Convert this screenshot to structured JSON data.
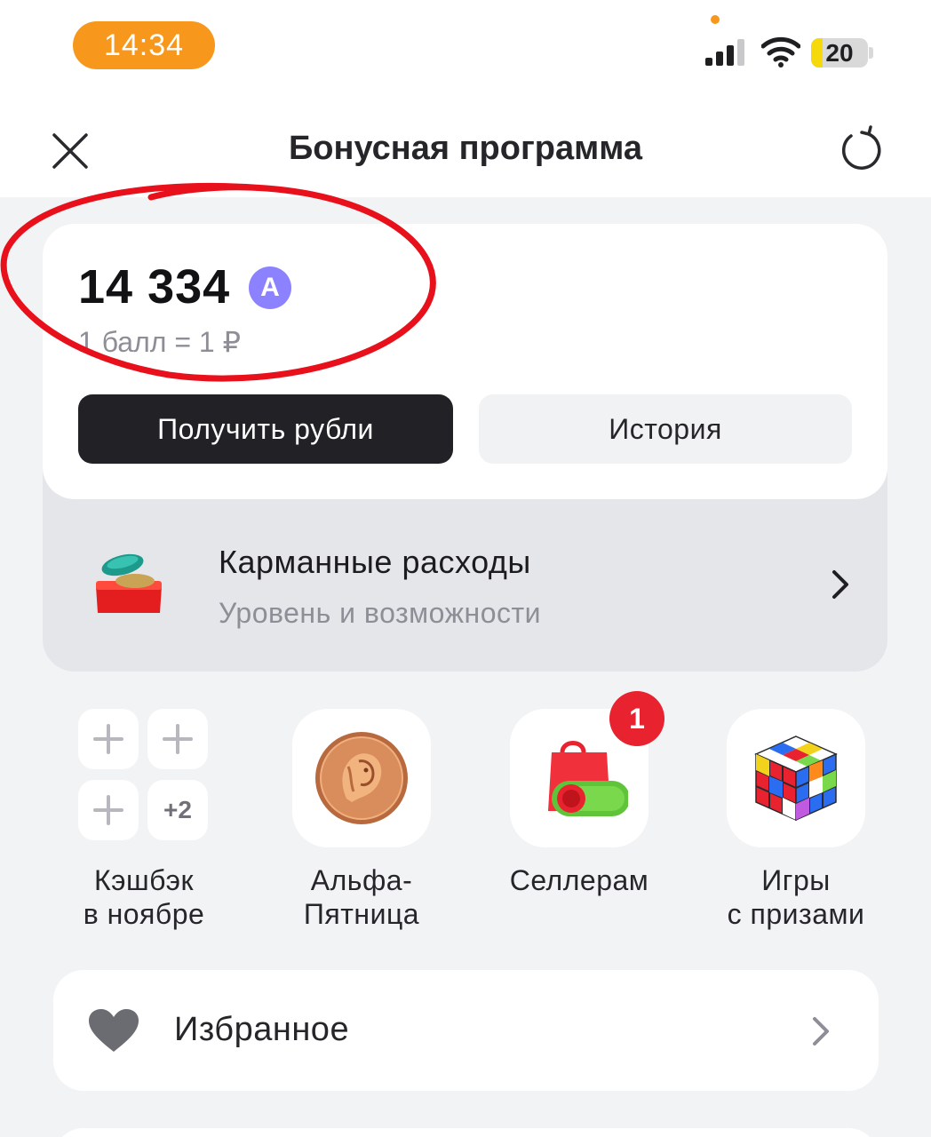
{
  "status_bar": {
    "time": "14:34",
    "battery": "20",
    "battery_level": 0.2
  },
  "header": {
    "title": "Бонусная программа",
    "close_icon": "close-icon",
    "refresh_icon": "refresh-icon"
  },
  "balance": {
    "amount": "14 334",
    "badge": "А",
    "rate": "1 балл = 1 ₽",
    "get_rubles_label": "Получить рубли",
    "history_label": "История"
  },
  "level": {
    "title": "Карманные расходы",
    "subtitle": "Уровень и возможности",
    "icon": "coin-chest-icon"
  },
  "tiles": [
    {
      "label_line1": "Кэшбэк",
      "label_line2": "в ноябре",
      "more": "+2",
      "icon": "plus-icon"
    },
    {
      "label_line1": "Альфа-",
      "label_line2": "Пятница",
      "icon": "lion-coin-icon"
    },
    {
      "label_line1": "Селлерам",
      "label_line2": "",
      "icon": "shopping-bag-icon",
      "badge": "1"
    },
    {
      "label_line1": "Игры",
      "label_line2": "с призами",
      "icon": "rubiks-cube-icon"
    }
  ],
  "favorites": {
    "label": "Избранное",
    "icon": "heart-icon"
  },
  "colors": {
    "status_time_bg": "#f7981c",
    "primary_button": "#222226",
    "points_badge": "#8c82ff",
    "notification_badge": "#e8222e",
    "annotation": "#e8101b"
  }
}
